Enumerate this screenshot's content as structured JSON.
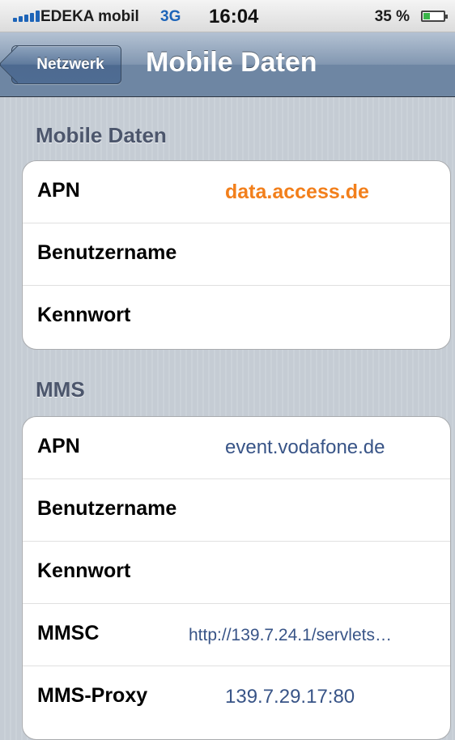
{
  "status_bar": {
    "carrier": "EDEKA mobil",
    "network_type": "3G",
    "time": "16:04",
    "battery_percent": "35 %",
    "battery_level": 0.35,
    "icons": [
      "signal-icon",
      "battery-icon"
    ]
  },
  "nav_bar": {
    "back_label": "Netzwerk",
    "title": "Mobile Daten"
  },
  "sections": {
    "mobile_data": {
      "header": "Mobile Daten",
      "rows": [
        {
          "label": "APN",
          "value": "data.access.de"
        },
        {
          "label": "Benutzername",
          "value": ""
        },
        {
          "label": "Kennwort",
          "value": ""
        }
      ]
    },
    "mms": {
      "header": "MMS",
      "rows": [
        {
          "label": "APN",
          "value": "event.vodafone.de"
        },
        {
          "label": "Benutzername",
          "value": ""
        },
        {
          "label": "Kennwort",
          "value": ""
        },
        {
          "label": "MMSC",
          "value": "http://139.7.24.1/servlets…"
        },
        {
          "label": "MMS-Proxy",
          "value": "139.7.29.17:80"
        }
      ]
    }
  },
  "colors": {
    "accent_value": "#f27f1b",
    "value_text": "#385487",
    "nav_bar": "#6e86a3",
    "background": "#c5ccd4"
  }
}
